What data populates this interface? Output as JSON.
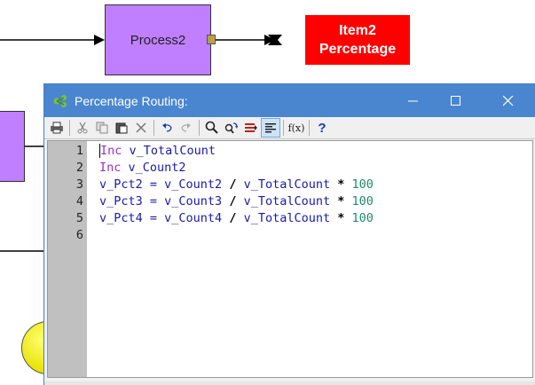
{
  "diagram": {
    "process_label": "Process2",
    "item_label_line1": "Item2",
    "item_label_line2": "Percentage",
    "process_color": "#bf7fff",
    "label_color": "#ff0000"
  },
  "window": {
    "title": "Percentage Routing:",
    "titlebar_color": "#4a86cf",
    "buttons": [
      "minimize-icon",
      "maximize-icon",
      "close-icon"
    ]
  },
  "toolbar": {
    "items": [
      "print-icon",
      "cut-icon",
      "copy-icon",
      "paste-icon",
      "delete-icon",
      "undo-icon",
      "redo-icon",
      "find-icon",
      "find-replace-icon",
      "bookmark-icon",
      "format-icon",
      "function-icon",
      "help-icon"
    ],
    "function_label": "f(x)",
    "help_label": "?"
  },
  "editor": {
    "line_numbers": [
      "1",
      "2",
      "3",
      "4",
      "5",
      "6"
    ],
    "lines": [
      {
        "kw": "Inc",
        "rest": " v_TotalCount"
      },
      {
        "kw": "Inc",
        "rest": " v_Count2"
      },
      {
        "lhs": "v_Pct2 = v_Count2 ",
        "div": "/",
        "mid": " v_TotalCount ",
        "mul": "*",
        "num": " 100"
      },
      {
        "lhs": "v_Pct3 = v_Count3 ",
        "div": "/",
        "mid": " v_TotalCount ",
        "mul": "*",
        "num": " 100"
      },
      {
        "lhs": "v_Pct4 = v_Count4 ",
        "div": "/",
        "mid": " v_TotalCount ",
        "mul": "*",
        "num": " 100"
      }
    ]
  }
}
